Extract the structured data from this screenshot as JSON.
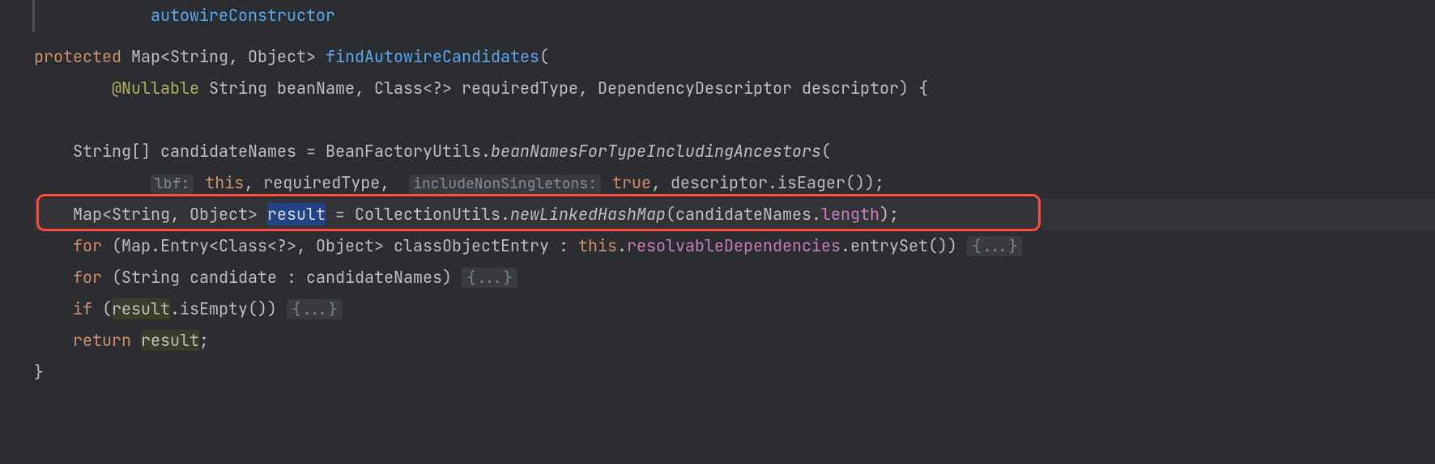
{
  "code": {
    "l0_link": "autowireConstructor",
    "l1": {
      "kw": "protected",
      "ret": "Map<String, Object>",
      "name": "findAutowireCandidates",
      "open": "("
    },
    "l2": {
      "ann": "@Nullable",
      "p1t": "String",
      "p1n": "beanName",
      "c1": ", ",
      "p2t": "Class<?>",
      "p2n": "requiredType",
      "c2": ", ",
      "p3t": "DependencyDescriptor",
      "p3n": "descriptor",
      "end": ") {"
    },
    "l4": {
      "t": "String[]",
      "n": "candidateNames",
      "eq": " = ",
      "cls": "BeanFactoryUtils",
      "dot": ".",
      "m": "beanNamesForTypeIncludingAncestors",
      "open": "("
    },
    "l5": {
      "h1": "lbf:",
      "this": "this",
      "c1": ", ",
      "a2": "requiredType",
      "c2": ", ",
      "h2": "includeNonSingletons:",
      "a3": "true",
      "c3": ", ",
      "a4a": "descriptor",
      "a4d": ".",
      "a4m": "isEager",
      "end": "());"
    },
    "l6": {
      "t": "Map<String, Object>",
      "n": "result",
      "eq": " = ",
      "cls": "CollectionUtils",
      "dot": ".",
      "m": "newLinkedHashMap",
      "open": "(",
      "a1": "candidateNames",
      "d": ".",
      "f": "length",
      "end": ");"
    },
    "l7": {
      "kw": "for",
      "open": " (",
      "t1": "Map.Entry<Class<?>, Object>",
      "n": "classObjectEntry",
      "in": " : ",
      "this": "this",
      "d": ".",
      "f": "resolvableDependencies",
      "d2": ".",
      "m": "entrySet",
      "close": "()) ",
      "fold": "{...}"
    },
    "l8": {
      "kw": "for",
      "open": " (",
      "t": "String",
      "n": "candidate",
      "in": " : ",
      "arr": "candidateNames",
      "close": ") ",
      "fold": "{...}"
    },
    "l9": {
      "kw": "if",
      "open": " (",
      "v": "result",
      "d": ".",
      "m": "isEmpty",
      "close": "()) ",
      "fold": "{...}"
    },
    "l10": {
      "kw": "return",
      "sp": " ",
      "v": "result",
      "end": ";"
    },
    "l11": {
      "brace": "}"
    }
  }
}
